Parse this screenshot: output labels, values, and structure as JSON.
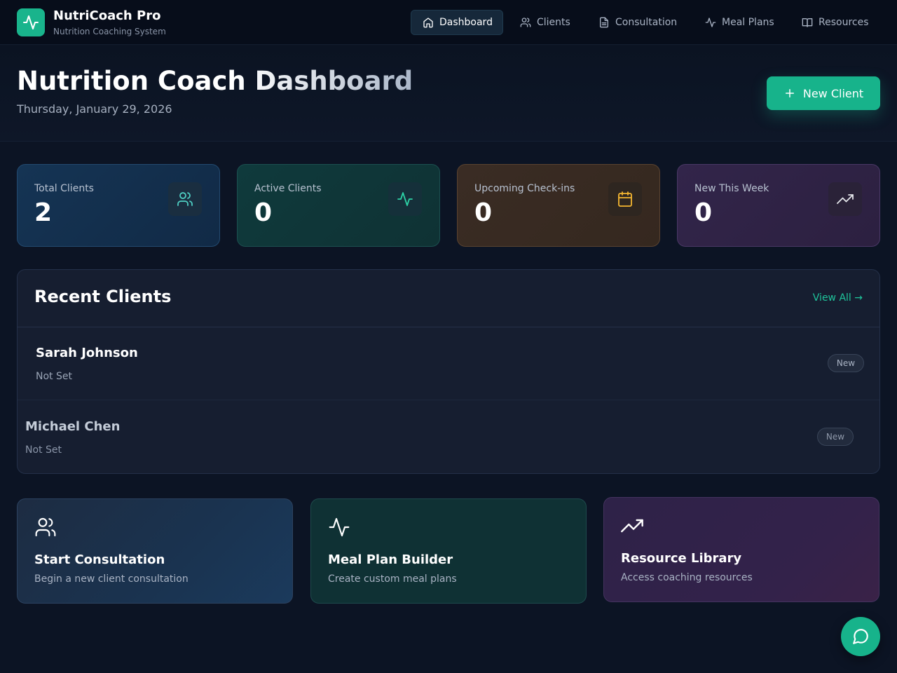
{
  "app": {
    "name": "NutriCoach Pro",
    "subtitle": "Nutrition Coaching System",
    "logo_icon": "activity-icon",
    "accent": "#17b38b"
  },
  "nav": {
    "items": [
      {
        "label": "Dashboard",
        "icon": "home-icon",
        "active": true
      },
      {
        "label": "Clients",
        "icon": "users-icon",
        "active": false
      },
      {
        "label": "Consultation",
        "icon": "document-icon",
        "active": false
      },
      {
        "label": "Meal Plans",
        "icon": "activity-icon",
        "active": false
      },
      {
        "label": "Resources",
        "icon": "book-icon",
        "active": false
      }
    ]
  },
  "header": {
    "title": "Nutrition Coach Dashboard",
    "date": "Thursday, January 29, 2026",
    "new_client_label": "New Client"
  },
  "stats": [
    {
      "label": "Total Clients",
      "value": "2",
      "icon": "users-icon",
      "color": "#4fd1c5"
    },
    {
      "label": "Active Clients",
      "value": "0",
      "icon": "activity-icon",
      "color": "#2dd4a7"
    },
    {
      "label": "Upcoming Check-ins",
      "value": "0",
      "icon": "calendar-icon",
      "color": "#f5b731"
    },
    {
      "label": "New This Week",
      "value": "0",
      "icon": "trending-up-icon",
      "color": "#e5e7eb"
    }
  ],
  "recent_clients": {
    "title": "Recent Clients",
    "view_all_label": "View All →",
    "clients": [
      {
        "name": "Sarah Johnson",
        "goal": "Not Set",
        "badge": "New"
      },
      {
        "name": "Michael Chen",
        "goal": "Not Set",
        "badge": "New"
      }
    ]
  },
  "actions": [
    {
      "title": "Start Consultation",
      "description": "Begin a new client consultation",
      "icon": "users-icon"
    },
    {
      "title": "Meal Plan Builder",
      "description": "Create custom meal plans",
      "icon": "activity-icon"
    },
    {
      "title": "Resource Library",
      "description": "Access coaching resources",
      "icon": "trending-up-icon"
    }
  ],
  "chat": {
    "icon": "chat-bubble-icon"
  }
}
